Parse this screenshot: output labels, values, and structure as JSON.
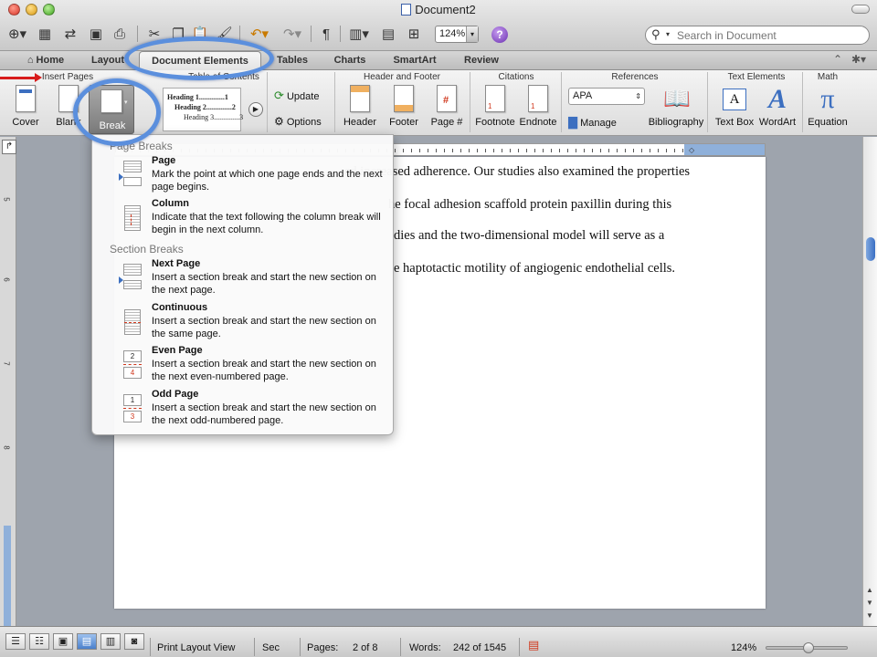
{
  "window": {
    "title": "Document2"
  },
  "toolbar": {
    "zoom_value": "124%",
    "search_placeholder": "Search in Document"
  },
  "tabs": [
    {
      "label": "Home"
    },
    {
      "label": "Layout"
    },
    {
      "label": "Document Elements"
    },
    {
      "label": "Tables"
    },
    {
      "label": "Charts"
    },
    {
      "label": "SmartArt"
    },
    {
      "label": "Review"
    }
  ],
  "ribbon": {
    "groups": {
      "insert_pages": "Insert Pages",
      "toc": "Table of Contents",
      "header_footer": "Header and Footer",
      "citations": "Citations",
      "references": "References",
      "text_elements": "Text Elements",
      "math": "Math"
    },
    "buttons": {
      "cover": "Cover",
      "blank": "Blank",
      "break": "Break",
      "update": "Update",
      "options": "Options",
      "header": "Header",
      "footer": "Footer",
      "page_num": "Page #",
      "footnote": "Footnote",
      "endnote": "Endnote",
      "manage": "Manage",
      "bibliography": "Bibliography",
      "text_box": "Text Box",
      "wordart": "WordArt",
      "equation": "Equation"
    },
    "toc_preview": [
      "Heading 1..............1",
      "Heading 2..............2",
      "Heading 3..............3"
    ],
    "citation_style": "APA"
  },
  "break_menu": {
    "page_breaks_header": "Page Breaks",
    "section_breaks_header": "Section Breaks",
    "items": [
      {
        "title": "Page",
        "desc": "Mark the point at which one page ends and the next page begins."
      },
      {
        "title": "Column",
        "desc": "Indicate that the text following the column break will begin in the next column."
      },
      {
        "title": "Next Page",
        "desc": "Insert a section break and start the new section on the next page."
      },
      {
        "title": "Continuous",
        "desc": "Insert a section break and start the new section on the same page."
      },
      {
        "title": "Even Page",
        "desc": "Insert a section break and start the new section on the next even-numbered page."
      },
      {
        "title": "Odd Page",
        "desc": "Insert a section break and start the new section on the next odd-numbered page."
      }
    ]
  },
  "document": {
    "lines": [
      "ed increased adherence. Our studies also examined the properties",
      "he focal adhesion scaffold protein paxillin during this",
      "dies and the two-dimensional model will serve as a",
      "e haptotactic motility of angiogenic endothelial cells."
    ]
  },
  "status": {
    "view": "Print Layout View",
    "sec_label": "Sec",
    "pages_label": "Pages:",
    "pages_value": "2 of 8",
    "words_label": "Words:",
    "words_value": "242 of 1545",
    "zoom": "124%"
  }
}
